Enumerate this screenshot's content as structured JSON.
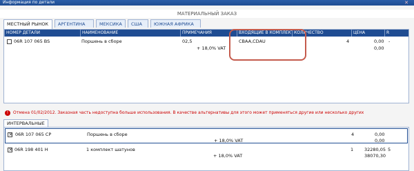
{
  "window": {
    "title": "Информация по детали",
    "close": "✕"
  },
  "subheader": "МАТЕРИАЛЬНЫЙ ЗАКАЗ",
  "tabs": [
    {
      "label": "МЕСТНЫЙ РЫНОК"
    },
    {
      "label": "АРГЕНТИНА"
    },
    {
      "label": "МЕКСИКА"
    },
    {
      "label": "США"
    },
    {
      "label": "ЮЖНАЯ АФРИКА"
    }
  ],
  "table": {
    "headers": [
      "НОМЕР ДЕТАЛИ",
      "НАИМЕНОВАНИЕ",
      "ПРИМЕЧАНИЯ",
      "ВХОДЯЩИЕ В КОМПЛЕКТ",
      "КОЛИЧЕСТВО",
      "ЦЕНА",
      "R"
    ],
    "row": {
      "part": "06R 107 065 BS",
      "name": "Поршень в сборе",
      "note": "02,5",
      "vat": "+ 18,0% VAT",
      "included": "CBAA,CDAU",
      "qty": "4",
      "price1": "0,00",
      "price2": "0,00",
      "r": "-"
    }
  },
  "notice": {
    "icon": "!",
    "text": "Отмена 01/02/2012. Заказная часть недоступна больше использования. В качестве альтернативы для этого может применяться другие или несколько других"
  },
  "inter_tab": "ИНТЕРВАЛЬНЫЕ",
  "inter_rows": [
    {
      "part": "06R 107 065 CP",
      "name": "Поршень в сборе",
      "vat": "+ 18,0% VAT",
      "qty": "4",
      "price1": "0,00",
      "price2": "0,00",
      "r": ""
    },
    {
      "part": "06R 198 401 H",
      "name": "1 комплект шатунов",
      "vat": "+ 18,0% VAT",
      "qty": "1",
      "price1": "32280,05",
      "price2": "38070,30",
      "r": "5"
    }
  ]
}
